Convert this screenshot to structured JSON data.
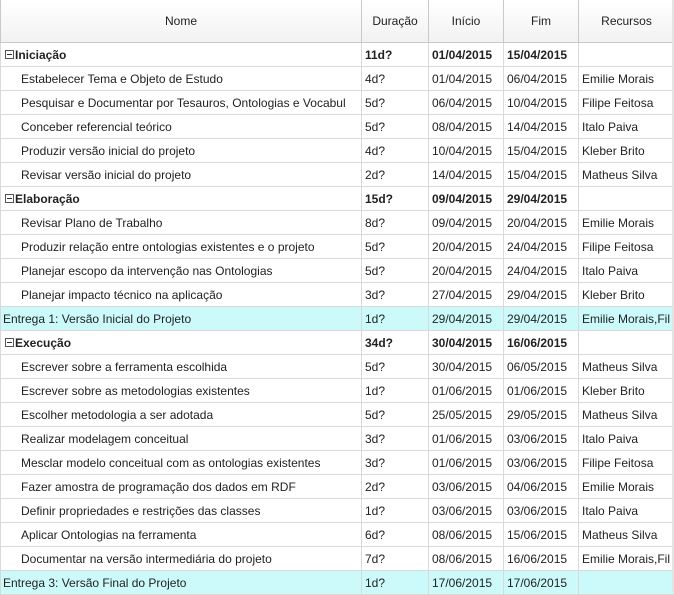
{
  "columns": {
    "nome": "Nome",
    "duracao": "Duração",
    "inicio": "Início",
    "fim": "Fim",
    "recursos": "Recursos"
  },
  "rows": [
    {
      "type": "group",
      "name": "Iniciação",
      "duracao": "11d?",
      "inicio": "01/04/2015",
      "fim": "15/04/2015",
      "recursos": ""
    },
    {
      "type": "task",
      "name": "Estabelecer Tema e Objeto de Estudo",
      "duracao": "4d?",
      "inicio": "01/04/2015",
      "fim": "06/04/2015",
      "recursos": "Emilie Morais"
    },
    {
      "type": "task",
      "name": "Pesquisar e Documentar por Tesauros, Ontologias e Vocabul",
      "duracao": "5d?",
      "inicio": "06/04/2015",
      "fim": "10/04/2015",
      "recursos": "Filipe Feitosa"
    },
    {
      "type": "task",
      "name": "Conceber referencial teórico",
      "duracao": "5d?",
      "inicio": "08/04/2015",
      "fim": "14/04/2015",
      "recursos": "Italo Paiva"
    },
    {
      "type": "task",
      "name": "Produzir versão inicial do projeto",
      "duracao": "4d?",
      "inicio": "10/04/2015",
      "fim": "15/04/2015",
      "recursos": "Kleber Brito"
    },
    {
      "type": "task",
      "name": "Revisar versão inicial do projeto",
      "duracao": "2d?",
      "inicio": "14/04/2015",
      "fim": "15/04/2015",
      "recursos": "Matheus Silva"
    },
    {
      "type": "group",
      "name": "Elaboração",
      "duracao": "15d?",
      "inicio": "09/04/2015",
      "fim": "29/04/2015",
      "recursos": ""
    },
    {
      "type": "task",
      "name": "Revisar Plano de Trabalho",
      "duracao": "8d?",
      "inicio": "09/04/2015",
      "fim": "20/04/2015",
      "recursos": "Emilie Morais"
    },
    {
      "type": "task",
      "name": "Produzir relação entre ontologias existentes e o projeto",
      "duracao": "5d?",
      "inicio": "20/04/2015",
      "fim": "24/04/2015",
      "recursos": "Filipe Feitosa"
    },
    {
      "type": "task",
      "name": "Planejar escopo da intervenção nas Ontologias",
      "duracao": "5d?",
      "inicio": "20/04/2015",
      "fim": "24/04/2015",
      "recursos": "Italo Paiva"
    },
    {
      "type": "task",
      "name": "Planejar impacto técnico na aplicação",
      "duracao": "3d?",
      "inicio": "27/04/2015",
      "fim": "29/04/2015",
      "recursos": "Kleber Brito"
    },
    {
      "type": "milestone",
      "name": "Entrega 1: Versão Inicial do Projeto",
      "duracao": "1d?",
      "inicio": "29/04/2015",
      "fim": "29/04/2015",
      "recursos": "Emilie Morais,Fil"
    },
    {
      "type": "group",
      "name": "Execução",
      "duracao": "34d?",
      "inicio": "30/04/2015",
      "fim": "16/06/2015",
      "recursos": ""
    },
    {
      "type": "task",
      "name": "Escrever sobre a ferramenta escolhida",
      "duracao": "5d?",
      "inicio": "30/04/2015",
      "fim": "06/05/2015",
      "recursos": "Matheus Silva"
    },
    {
      "type": "task",
      "name": "Escrever sobre as metodologias existentes",
      "duracao": "1d?",
      "inicio": "01/06/2015",
      "fim": "01/06/2015",
      "recursos": "Kleber Brito"
    },
    {
      "type": "task",
      "name": "Escolher metodologia a ser adotada",
      "duracao": "5d?",
      "inicio": "25/05/2015",
      "fim": "29/05/2015",
      "recursos": "Matheus Silva"
    },
    {
      "type": "task",
      "name": "Realizar modelagem conceitual",
      "duracao": "3d?",
      "inicio": "01/06/2015",
      "fim": "03/06/2015",
      "recursos": "Italo Paiva"
    },
    {
      "type": "task",
      "name": "Mesclar modelo conceitual com as ontologias existentes",
      "duracao": "3d?",
      "inicio": "01/06/2015",
      "fim": "03/06/2015",
      "recursos": "Filipe Feitosa"
    },
    {
      "type": "task",
      "name": "Fazer amostra de programação dos dados em RDF",
      "duracao": "2d?",
      "inicio": "03/06/2015",
      "fim": "04/06/2015",
      "recursos": "Emilie Morais"
    },
    {
      "type": "task",
      "name": "Definir propriedades e restrições das classes",
      "duracao": "1d?",
      "inicio": "03/06/2015",
      "fim": "03/06/2015",
      "recursos": "Italo Paiva"
    },
    {
      "type": "task",
      "name": "Aplicar Ontologias na ferramenta",
      "duracao": "6d?",
      "inicio": "08/06/2015",
      "fim": "15/06/2015",
      "recursos": "Matheus Silva"
    },
    {
      "type": "task",
      "name": "Documentar na versão intermediária do projeto",
      "duracao": "7d?",
      "inicio": "08/06/2015",
      "fim": "16/06/2015",
      "recursos": "Emilie Morais,Fil"
    },
    {
      "type": "milestone",
      "name": "Entrega 3: Versão Final do Projeto",
      "duracao": "1d?",
      "inicio": "17/06/2015",
      "fim": "17/06/2015",
      "recursos": ""
    }
  ]
}
